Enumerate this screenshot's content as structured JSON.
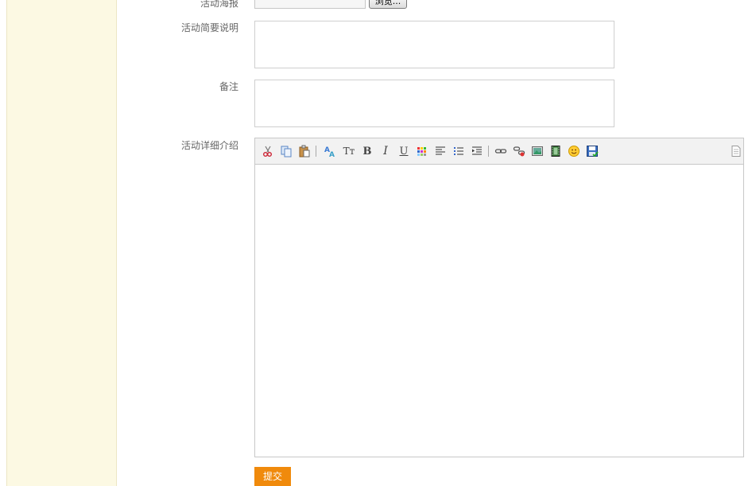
{
  "form": {
    "poster_label": "活动海报",
    "browse_label": "浏览...",
    "summary_label": "活动简要说明",
    "remark_label": "备注",
    "detail_label": "活动详细介绍",
    "submit_label": "提交"
  },
  "editor": {
    "toolbar_text": {
      "bold": "B",
      "italic": "I",
      "underline": "U",
      "fontsize": "Tт"
    },
    "toolbar_icons": [
      "cut-icon",
      "copy-icon",
      "paste-icon",
      "translate-icon",
      "font-size-icon",
      "bold-icon",
      "italic-icon",
      "underline-icon",
      "color-icon",
      "align-icon",
      "list-icon",
      "indent-icon",
      "link-icon",
      "unlink-icon",
      "image-icon",
      "video-icon",
      "emoticon-icon",
      "save-icon",
      "source-icon"
    ]
  },
  "colors": {
    "sidebar": "#fcf9e3",
    "submit": "#f08a0c"
  }
}
